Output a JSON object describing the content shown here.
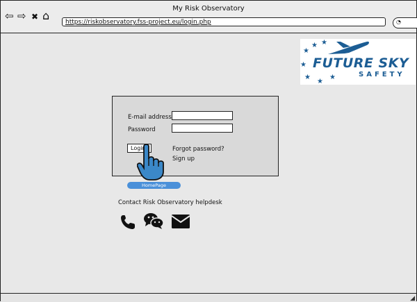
{
  "window": {
    "title": "My Risk Observatory"
  },
  "nav": {
    "back": "⇦",
    "forward": "⇨",
    "stop": "✖",
    "home": "⌂"
  },
  "address_bar": {
    "url": "https://riskobservatory.fss-project.eu/login.php"
  },
  "logo": {
    "main_text": "FUTURE SKY",
    "sub_text": "SAFETY",
    "brand_color": "#1c5d94"
  },
  "login": {
    "email_label": "E-mail address",
    "password_label": "Password",
    "login_button": "Login",
    "forgot_link": "Forgot password?",
    "signup_link": "Sign up"
  },
  "homepage_button": "HomePage",
  "helpdesk": {
    "title": "Contact Risk Observatory helpdesk",
    "icons": [
      "phone-icon",
      "wechat-icon",
      "mail-icon"
    ]
  },
  "colors": {
    "homepage_button": "#4a90d9",
    "panel": "#d9d9d9",
    "background": "#e8e8e8"
  }
}
